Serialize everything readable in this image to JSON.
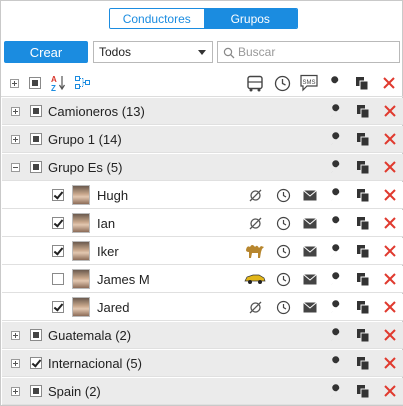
{
  "tabs": [
    {
      "label": "Conductores",
      "active": false
    },
    {
      "label": "Grupos",
      "active": true
    }
  ],
  "toolbar": {
    "create_label": "Crear",
    "filter_value": "Todos",
    "search_placeholder": "Buscar"
  },
  "header_icons": [
    "expand-all-icon",
    "select-all-icon",
    "sort-az-icon",
    "hierarchy-icon",
    "bus-icon",
    "clock-icon",
    "sms-icon",
    "wrench-icon",
    "copy-icon",
    "delete-icon"
  ],
  "rows": [
    {
      "type": "group",
      "label": "Camioneros (13)",
      "expanded": false,
      "check": "partial"
    },
    {
      "type": "group",
      "label": "Grupo 1 (14)",
      "expanded": false,
      "check": "partial"
    },
    {
      "type": "group",
      "label": "Grupo Es (5)",
      "expanded": true,
      "check": "partial"
    },
    {
      "type": "member",
      "label": "Hugh",
      "checked": true,
      "unit_icon": "unbind-icon"
    },
    {
      "type": "member",
      "label": "Ian",
      "checked": true,
      "unit_icon": "unbind-icon"
    },
    {
      "type": "member",
      "label": "Iker",
      "checked": true,
      "unit_icon": "camel-icon"
    },
    {
      "type": "member",
      "label": "James M",
      "checked": false,
      "unit_icon": "car-icon"
    },
    {
      "type": "member",
      "label": "Jared",
      "checked": true,
      "unit_icon": "unbind-icon"
    },
    {
      "type": "group",
      "label": "Guatemala (2)",
      "expanded": false,
      "check": "partial"
    },
    {
      "type": "group",
      "label": "Internacional (5)",
      "expanded": false,
      "check": "checked"
    },
    {
      "type": "group",
      "label": "Spain (2)",
      "expanded": false,
      "check": "partial"
    }
  ],
  "colors": {
    "accent": "#1b8ce0",
    "delete": "#e03a2f",
    "group_bg": "#ebebeb"
  }
}
